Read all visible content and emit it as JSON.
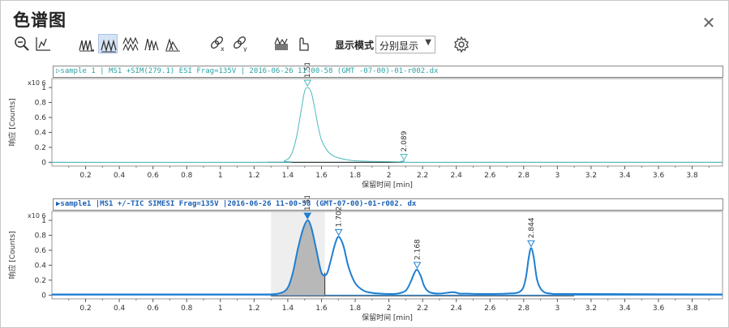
{
  "window": {
    "title": "色谱图",
    "close_label": "✕"
  },
  "toolbar": {
    "buttons": [
      {
        "name": "zoom-out-icon"
      },
      {
        "name": "autoscale-icon"
      },
      {
        "name": "overlay-peaks-icon"
      },
      {
        "name": "separate-peaks-icon"
      },
      {
        "name": "stack-peaks-icon"
      },
      {
        "name": "offset-peaks-icon"
      },
      {
        "name": "area-peaks-icon"
      },
      {
        "name": "link-x-icon"
      },
      {
        "name": "link-y-icon"
      },
      {
        "name": "integrate-icon"
      },
      {
        "name": "hand-pointer-icon"
      }
    ],
    "mode_label": "显示模式",
    "mode_value": "分别显示",
    "settings_icon": "gear-icon"
  },
  "colors": {
    "trace1": "#4fb8c0",
    "trace2": "#1f7fd1",
    "shade": "#d9d9d9",
    "peakfill": "#b8b8b8"
  },
  "chart_data": [
    {
      "type": "line",
      "header": "▷sample 1 | MS1 +SIM(279.1) ESI Frag=135V | 2016-06-26 11-00-58 (GMT -07-00)-01-r002.dx",
      "ylabel": "响应 [Counts]",
      "yexp": "x10 6",
      "xlabel": "保留时间 [min]",
      "xlim": [
        0.0,
        3.98
      ],
      "ylim": [
        -0.05,
        1.12
      ],
      "xticks": [
        "0.2",
        "0.4",
        "0.6",
        "0.8",
        "1",
        "1.2",
        "1.4",
        "1.6",
        "1.8",
        "2",
        "2.2",
        "2.4",
        "2.6",
        "2.8",
        "3",
        "3.2",
        "3.4",
        "3.6",
        "3.8"
      ],
      "yticks": [
        "0",
        "0.2",
        "0.4",
        "0.6",
        "0.8",
        "1"
      ],
      "baseline_range": [
        1.28,
        2.08
      ],
      "peaks": [
        {
          "label": "1.517",
          "x": 1.517,
          "y": 1.0
        },
        {
          "label": "2.089",
          "x": 2.089,
          "y": 0.01
        }
      ],
      "series": [
        {
          "x": [
            0.0,
            1.3,
            1.38,
            1.42,
            1.45,
            1.48,
            1.5,
            1.52,
            1.54,
            1.56,
            1.58,
            1.6,
            1.63,
            1.66,
            1.7,
            1.75,
            1.8,
            1.9,
            2.0,
            2.08,
            2.09,
            2.1,
            2.5,
            3.98
          ],
          "y": [
            0.0,
            0.0,
            0.02,
            0.1,
            0.32,
            0.7,
            0.95,
            1.0,
            0.93,
            0.72,
            0.48,
            0.3,
            0.17,
            0.1,
            0.06,
            0.035,
            0.02,
            0.012,
            0.008,
            0.005,
            0.02,
            0.0,
            0.0,
            0.0
          ]
        }
      ]
    },
    {
      "type": "line",
      "header": "▶sample1 |MS1 +/-TIC SIMESI Frag=135V |2016-06-26 11-00-58 (GMT-07-00)-01-r002. dx",
      "ylabel": "响应 [Counts]",
      "yexp": "x10 6",
      "xlabel": "保留时间 [min]",
      "xlim": [
        0.0,
        3.98
      ],
      "ylim": [
        -0.05,
        1.12
      ],
      "xticks": [
        "0.2",
        "0.4",
        "0.6",
        "0.8",
        "1",
        "1.2",
        "1.4",
        "1.6",
        "1.8",
        "2",
        "2.2",
        "2.4",
        "2.6",
        "2.8",
        "3",
        "3.2",
        "3.4",
        "3.6",
        "3.8"
      ],
      "yticks": [
        "0",
        "0.2",
        "0.4",
        "0.6",
        "0.8",
        "1"
      ],
      "shade_range": [
        1.3,
        1.62
      ],
      "peak_fill_range": [
        1.34,
        1.62
      ],
      "peaks": [
        {
          "label": "1.517",
          "x": 1.517,
          "y": 1.0,
          "filled": true
        },
        {
          "label": "1.702",
          "x": 1.702,
          "y": 0.78
        },
        {
          "label": "2.168",
          "x": 2.168,
          "y": 0.34
        },
        {
          "label": "2.844",
          "x": 2.844,
          "y": 0.63
        }
      ],
      "series": [
        {
          "x": [
            0.0,
            1.2,
            1.3,
            1.36,
            1.4,
            1.43,
            1.46,
            1.49,
            1.517,
            1.54,
            1.57,
            1.6,
            1.63,
            1.65,
            1.68,
            1.702,
            1.73,
            1.76,
            1.8,
            1.85,
            1.9,
            1.95,
            2.0,
            2.05,
            2.1,
            2.13,
            2.15,
            2.168,
            2.19,
            2.21,
            2.24,
            2.3,
            2.38,
            2.42,
            2.46,
            2.55,
            2.7,
            2.78,
            2.81,
            2.83,
            2.844,
            2.86,
            2.88,
            2.91,
            2.96,
            3.1,
            3.98
          ],
          "y": [
            0.01,
            0.01,
            0.01,
            0.03,
            0.1,
            0.3,
            0.62,
            0.88,
            1.0,
            0.9,
            0.6,
            0.3,
            0.28,
            0.42,
            0.68,
            0.78,
            0.66,
            0.38,
            0.16,
            0.06,
            0.03,
            0.02,
            0.015,
            0.02,
            0.06,
            0.18,
            0.29,
            0.34,
            0.25,
            0.12,
            0.04,
            0.02,
            0.04,
            0.02,
            0.02,
            0.015,
            0.02,
            0.05,
            0.2,
            0.5,
            0.63,
            0.5,
            0.2,
            0.06,
            0.02,
            0.015,
            0.01
          ]
        }
      ]
    }
  ]
}
